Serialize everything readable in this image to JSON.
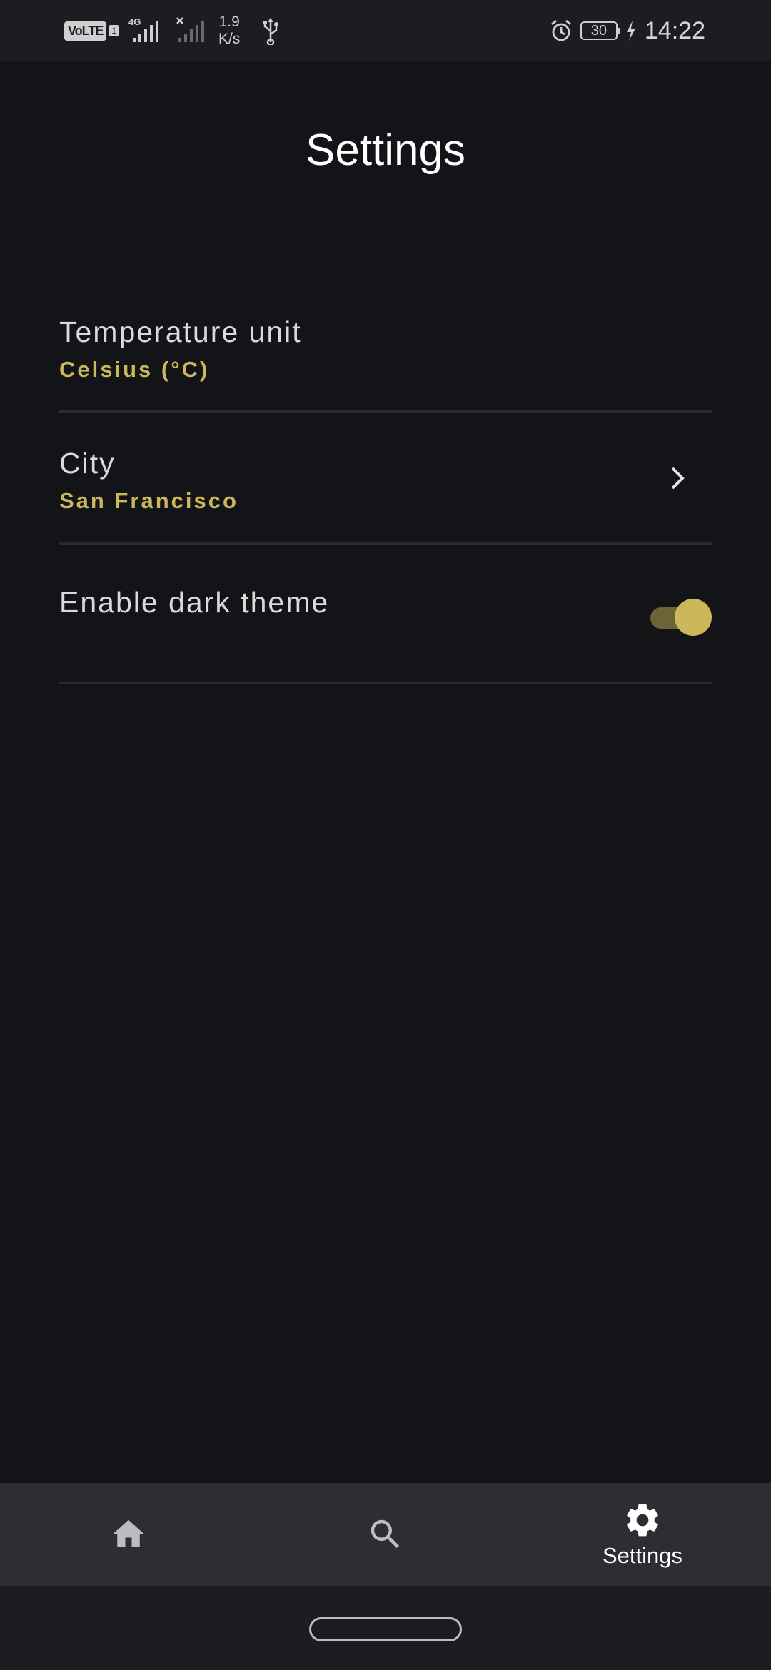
{
  "status_bar": {
    "volte": "VoLTE",
    "sim_number": "1",
    "network": "4G",
    "speed_value": "1.9",
    "speed_unit": "K/s",
    "battery": "30",
    "time": "14:22",
    "icons": [
      "volte-icon",
      "signal-icon",
      "no-signal-icon",
      "usb-icon",
      "alarm-icon",
      "battery-icon",
      "charging-icon"
    ]
  },
  "header": {
    "title": "Settings"
  },
  "settings": {
    "items": [
      {
        "title": "Temperature unit",
        "subtitle": "Celsius (°C)"
      },
      {
        "title": "City",
        "subtitle": "San Francisco",
        "icon": "chevron-right-icon"
      },
      {
        "title": "Enable dark theme",
        "toggle": true
      }
    ]
  },
  "bottom_nav": {
    "items": [
      {
        "icon": "home-icon",
        "label": ""
      },
      {
        "icon": "search-icon",
        "label": ""
      },
      {
        "icon": "gear-icon",
        "label": "Settings",
        "active": true
      }
    ]
  },
  "colors": {
    "background": "#131418",
    "accent": "#cdb75b",
    "nav_background": "#2d2e33",
    "title_text": "#ffffff",
    "item_text": "#dadada"
  }
}
